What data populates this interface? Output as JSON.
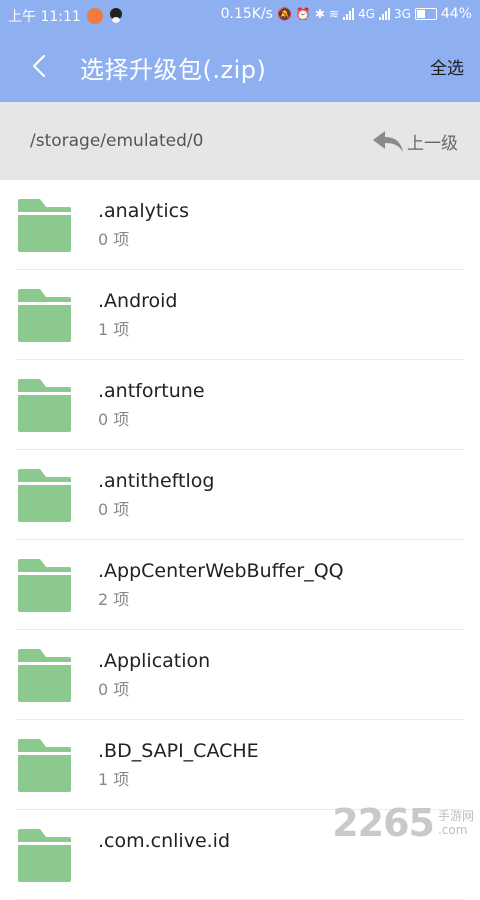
{
  "status_bar": {
    "time": "上午 11:11",
    "speed": "0.15K/s",
    "net1": "4G",
    "net2": "3G",
    "battery": "44%"
  },
  "header": {
    "title": "选择升级包(.zip)",
    "select_all": "全选"
  },
  "pathbar": {
    "path": "/storage/emulated/0",
    "up_label": "上一级"
  },
  "files": [
    {
      "name": ".analytics",
      "count": "0 项"
    },
    {
      "name": ".Android",
      "count": "1 项"
    },
    {
      "name": ".antfortune",
      "count": "0 项"
    },
    {
      "name": ".antitheftlog",
      "count": "0 项"
    },
    {
      "name": ".AppCenterWebBuffer_QQ",
      "count": "2 项"
    },
    {
      "name": ".Application",
      "count": "0 项"
    },
    {
      "name": ".BD_SAPI_CACHE",
      "count": "1 项"
    },
    {
      "name": ".com.cnlive.id",
      "count": ""
    }
  ],
  "watermark": {
    "main": "2265",
    "sub1": "手游网",
    "sub2": ".com"
  },
  "colors": {
    "header_bg": "#8eaff0",
    "folder": "#8bc98f",
    "pathbar_bg": "#e6e6e6"
  }
}
